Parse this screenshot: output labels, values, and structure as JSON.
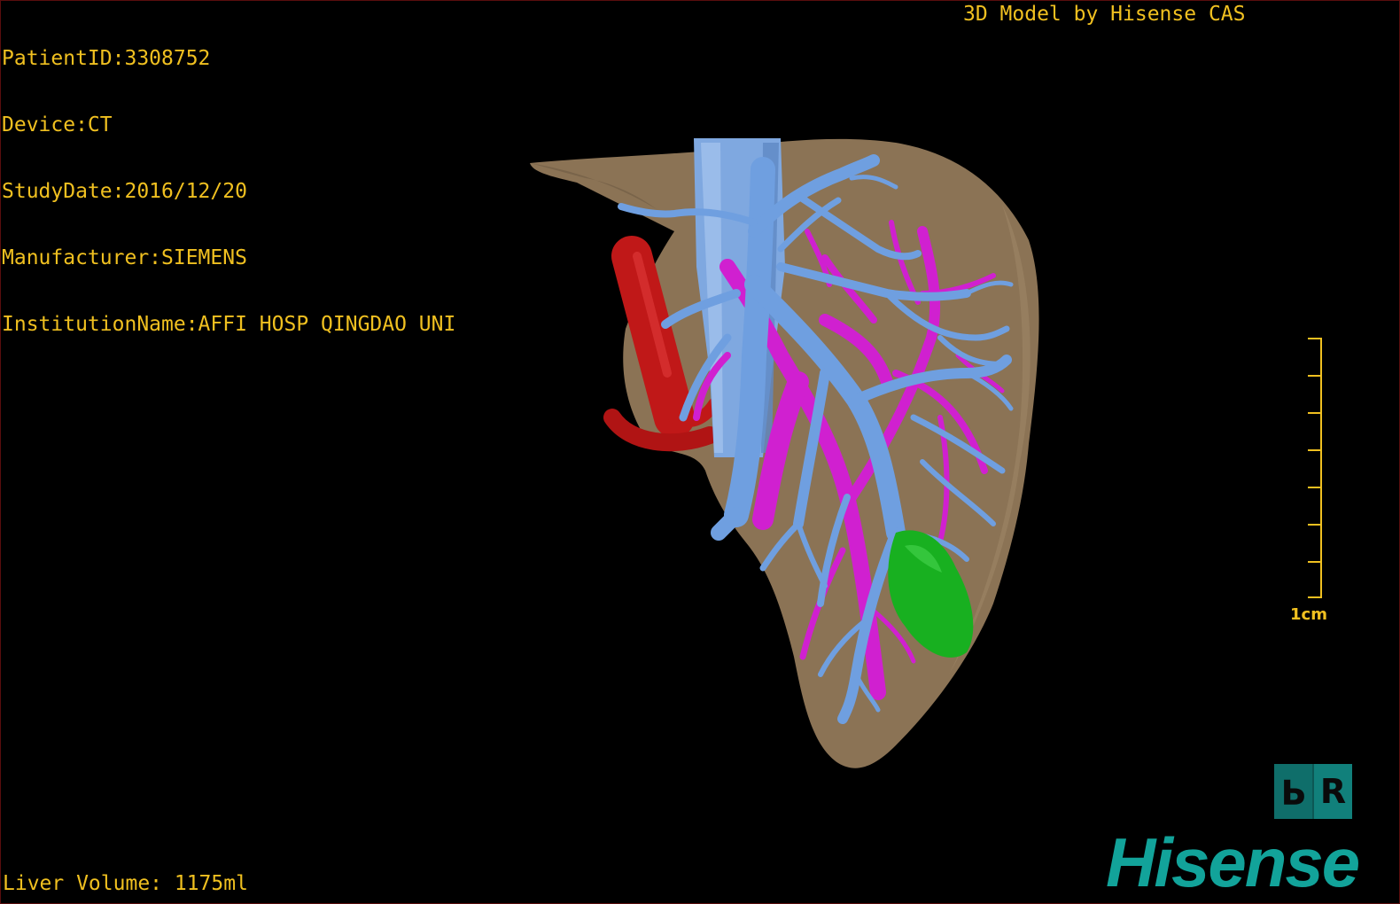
{
  "patient_info": {
    "patient_id": "PatientID:3308752",
    "device": "Device:CT",
    "study_date": "StudyDate:2016/12/20",
    "manufacturer": "Manufacturer:SIEMENS",
    "institution": "InstitutionName:AFFI HOSP QINGDAO UNI"
  },
  "model_credit": "3D Model by Hisense CAS",
  "liver_volume": "Liver Volume: 1175ml",
  "scale_bar": {
    "label": "1cm"
  },
  "orientation_cube": {
    "left_face": "P",
    "right_face": "R"
  },
  "brand": "Hisense",
  "colors": {
    "overlay_text": "#f0c020",
    "liver": "#8b7355",
    "portal_vein": "#6f9fe0",
    "hepatic_vein": "#d020d0",
    "artery": "#c01818",
    "tumor": "#18b020",
    "brand": "#12a39a"
  }
}
